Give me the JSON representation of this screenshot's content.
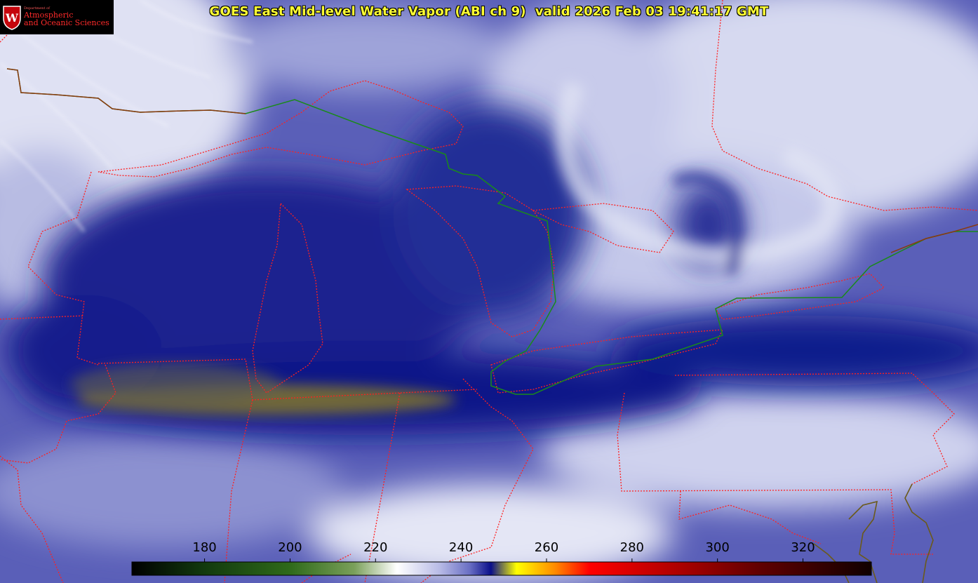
{
  "title": "GOES East Mid-level Water Vapor (ABI ch 9)  valid 2026 Feb 03 19:41:17 GMT",
  "logo": {
    "department": "Department of",
    "line1": "Atmospheric",
    "line2": "and Oceanic Sciences",
    "crest_letter": "W",
    "icon": "uw-crest-icon"
  },
  "colorbar": {
    "tick_labels": [
      "180",
      "200",
      "220",
      "240",
      "260",
      "280",
      "300",
      "320"
    ],
    "tick_values": [
      180,
      200,
      220,
      240,
      260,
      280,
      300,
      320
    ],
    "min_value": 163,
    "max_value": 336,
    "gradient_stops": [
      {
        "value": 163,
        "color": "#000000"
      },
      {
        "value": 180,
        "color": "#123a0e"
      },
      {
        "value": 200,
        "color": "#2f6a1a"
      },
      {
        "value": 215,
        "color": "#7aa05a"
      },
      {
        "value": 225,
        "color": "#ffffff"
      },
      {
        "value": 235,
        "color": "#b8bbe6"
      },
      {
        "value": 242,
        "color": "#6a6fc4"
      },
      {
        "value": 247,
        "color": "#0a0f8a"
      },
      {
        "value": 253,
        "color": "#ffff00"
      },
      {
        "value": 262,
        "color": "#ff8a00"
      },
      {
        "value": 270,
        "color": "#ff0000"
      },
      {
        "value": 290,
        "color": "#b00000"
      },
      {
        "value": 310,
        "color": "#600000"
      },
      {
        "value": 336,
        "color": "#100000"
      }
    ]
  },
  "colors": {
    "title": "#ffff33",
    "state_borders": "#ff2020",
    "intl_border": "#1a8a1a",
    "background_moist": "#cfd2ee",
    "background_dry": "#0c1688"
  }
}
